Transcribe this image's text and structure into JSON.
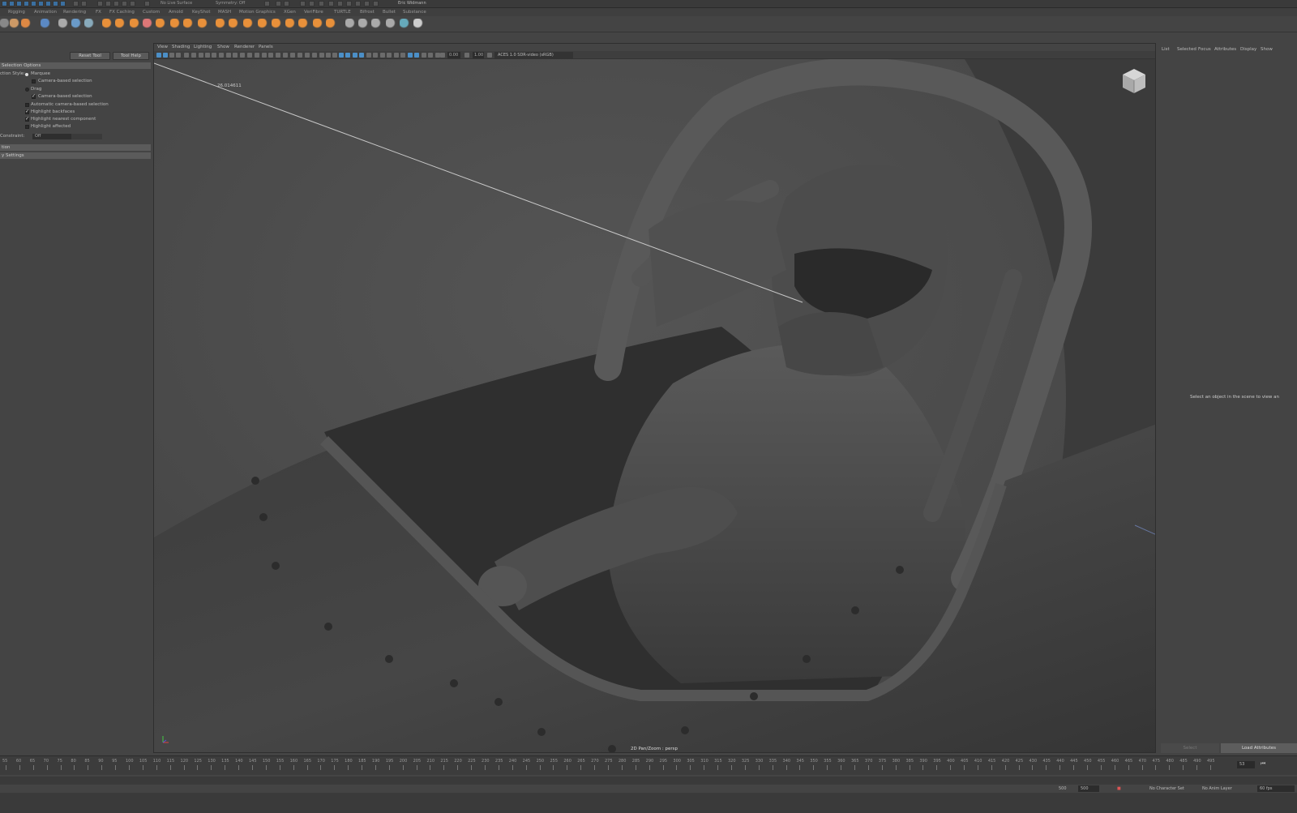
{
  "topbar": {
    "live_surface": "No Live Surface",
    "symmetry": "Symmetry: Off",
    "user": "Eric Widmann"
  },
  "shelf_tabs": [
    "Rigging",
    "Animation",
    "Rendering",
    "FX",
    "FX Caching",
    "Custom",
    "Arnold",
    "KeyShot",
    "MASH",
    "Motion Graphics",
    "XGen",
    "VeriFibre",
    "TURTLE",
    "Bifrost",
    "Bullet",
    "Substance"
  ],
  "left_panel": {
    "reset_tool": "Reset Tool",
    "tool_help": "Tool Help",
    "section_selection": "Selection Options",
    "selection_style_label": "ction Style:",
    "opt_marquee": "Marquee",
    "opt_camera_based_1": "Camera-based selection",
    "opt_drag": "Drag",
    "opt_camera_based_2": "Camera-based selection",
    "opt_automatic_camera": "Automatic camera-based selection",
    "opt_highlight_backfaces": "Highlight backfaces",
    "opt_highlight_nearest": "Highlight nearest component",
    "opt_highlight_affected": "Highlight affected",
    "constraint_label": "Constraint:",
    "constraint_value": "Off",
    "section_2": "tion",
    "section_3": "y Settings"
  },
  "viewport": {
    "menu": [
      "View",
      "Shading",
      "Lighting",
      "Show",
      "Renderer",
      "Panels"
    ],
    "field_1": "0.00",
    "field_2": "1.00",
    "color_space": "ACES 1.0 SDR-video (sRGB)",
    "measure_value": "26.014611",
    "caption": "2D Pan/Zoom : persp"
  },
  "right_panel": {
    "tabs": [
      "List",
      "Selected",
      "Focus",
      "Attributes",
      "Display",
      "Show"
    ],
    "message": "Select an object in the scene to view an",
    "select_button": "Select",
    "load_attributes_button": "Load Attributes"
  },
  "timeline": {
    "ticks": [
      "55",
      "60",
      "65",
      "70",
      "75",
      "80",
      "85",
      "90",
      "95",
      "100",
      "105",
      "110",
      "115",
      "120",
      "125",
      "130",
      "135",
      "140",
      "145",
      "150",
      "155",
      "160",
      "165",
      "170",
      "175",
      "180",
      "185",
      "190",
      "195",
      "200",
      "205",
      "210",
      "215",
      "220",
      "225",
      "230",
      "235",
      "240",
      "245",
      "250",
      "255",
      "260",
      "265",
      "270",
      "275",
      "280",
      "285",
      "290",
      "295",
      "300",
      "305",
      "310",
      "315",
      "320",
      "325",
      "330",
      "335",
      "340",
      "345",
      "350",
      "355",
      "360",
      "365",
      "370",
      "375",
      "380",
      "385",
      "390",
      "395",
      "400",
      "405",
      "410",
      "415",
      "420",
      "425",
      "430",
      "435",
      "440",
      "445",
      "450",
      "455",
      "460",
      "465",
      "470",
      "475",
      "480",
      "485",
      "490",
      "495"
    ],
    "current_frame": "53"
  },
  "statusbar": {
    "range_end_1": "500",
    "range_end_2": "500",
    "character_set": "No Character Set",
    "anim_layer": "No Anim Layer",
    "fps": "60 fps"
  }
}
